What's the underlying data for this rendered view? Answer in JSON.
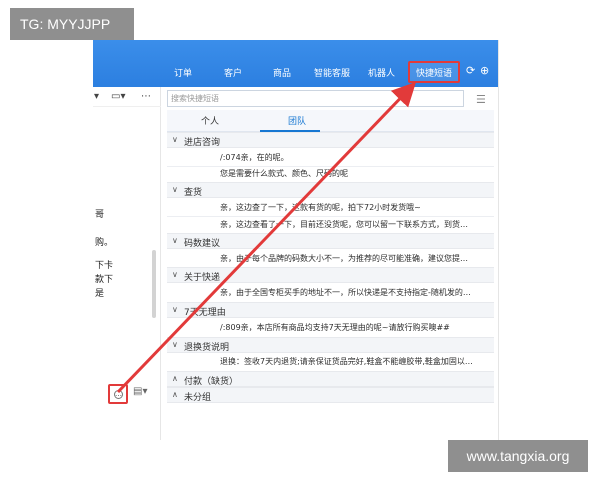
{
  "tag": "TG: MYYJJPP",
  "watermark": "www.tangxia.org",
  "top_nav": [
    "订单",
    "客户",
    "商品",
    "智能客服",
    "机器人",
    "快捷短语"
  ],
  "search": {
    "placeholder": "搜索快捷短语"
  },
  "tabs": {
    "person": "个人",
    "team": "团队"
  },
  "left_text": [
    "哥",
    "购。",
    "下卡",
    "款下",
    "是"
  ],
  "groups": [
    {
      "name": "进店咨询",
      "rows": [
        "/:074亲，在的呢。",
        "您是需要什么款式、颜色、尺码的呢"
      ]
    },
    {
      "name": "查货",
      "rows": [
        "亲，这边查了一下，这款有货的呢，拍下72小时发货哦~",
        "亲，这边查看了一下，目前还没货呢，您可以留一下联系方式，到货给..."
      ]
    },
    {
      "name": "码数建议",
      "rows": [
        "亲，由于每个品牌的码数大小不一，为推荐的尽可能准确，建议您提供您..."
      ]
    },
    {
      "name": "关于快递",
      "rows": [
        "亲，由于全国专柜买手的地址不一，所以快递是不支持指定-随机发的呢，..."
      ]
    },
    {
      "name": "7天无理由",
      "rows": [
        "/:809亲，本店所有商品均支持7天无理由的呢~请放行购买噢##"
      ]
    },
    {
      "name": "退换货说明",
      "rows": [
        "退换：签收7天内退货;请亲保证货品完好,鞋盒不能缠胶带,鞋盒加固以免退..."
      ]
    },
    {
      "name": "付款（缺货）",
      "rows": []
    },
    {
      "name": "未分组",
      "rows": []
    }
  ]
}
